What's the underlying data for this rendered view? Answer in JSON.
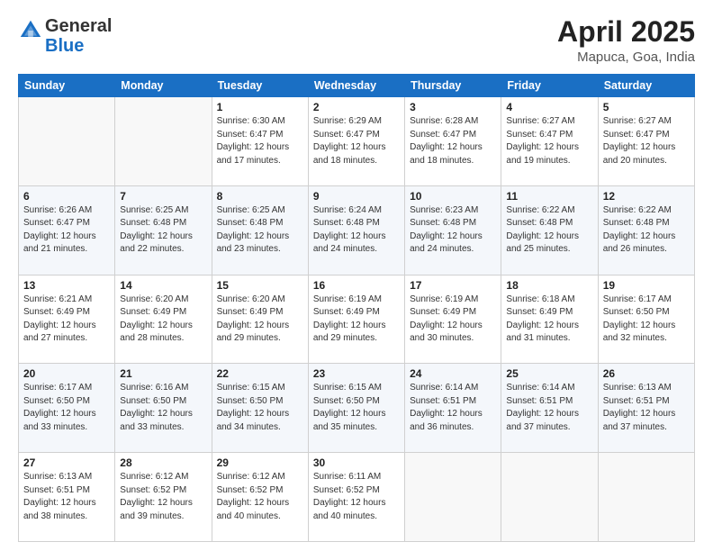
{
  "header": {
    "logo_general": "General",
    "logo_blue": "Blue",
    "title": "April 2025",
    "location": "Mapuca, Goa, India"
  },
  "days_of_week": [
    "Sunday",
    "Monday",
    "Tuesday",
    "Wednesday",
    "Thursday",
    "Friday",
    "Saturday"
  ],
  "weeks": [
    [
      {
        "day": "",
        "info": ""
      },
      {
        "day": "",
        "info": ""
      },
      {
        "day": "1",
        "info": "Sunrise: 6:30 AM\nSunset: 6:47 PM\nDaylight: 12 hours and 17 minutes."
      },
      {
        "day": "2",
        "info": "Sunrise: 6:29 AM\nSunset: 6:47 PM\nDaylight: 12 hours and 18 minutes."
      },
      {
        "day": "3",
        "info": "Sunrise: 6:28 AM\nSunset: 6:47 PM\nDaylight: 12 hours and 18 minutes."
      },
      {
        "day": "4",
        "info": "Sunrise: 6:27 AM\nSunset: 6:47 PM\nDaylight: 12 hours and 19 minutes."
      },
      {
        "day": "5",
        "info": "Sunrise: 6:27 AM\nSunset: 6:47 PM\nDaylight: 12 hours and 20 minutes."
      }
    ],
    [
      {
        "day": "6",
        "info": "Sunrise: 6:26 AM\nSunset: 6:47 PM\nDaylight: 12 hours and 21 minutes."
      },
      {
        "day": "7",
        "info": "Sunrise: 6:25 AM\nSunset: 6:48 PM\nDaylight: 12 hours and 22 minutes."
      },
      {
        "day": "8",
        "info": "Sunrise: 6:25 AM\nSunset: 6:48 PM\nDaylight: 12 hours and 23 minutes."
      },
      {
        "day": "9",
        "info": "Sunrise: 6:24 AM\nSunset: 6:48 PM\nDaylight: 12 hours and 24 minutes."
      },
      {
        "day": "10",
        "info": "Sunrise: 6:23 AM\nSunset: 6:48 PM\nDaylight: 12 hours and 24 minutes."
      },
      {
        "day": "11",
        "info": "Sunrise: 6:22 AM\nSunset: 6:48 PM\nDaylight: 12 hours and 25 minutes."
      },
      {
        "day": "12",
        "info": "Sunrise: 6:22 AM\nSunset: 6:48 PM\nDaylight: 12 hours and 26 minutes."
      }
    ],
    [
      {
        "day": "13",
        "info": "Sunrise: 6:21 AM\nSunset: 6:49 PM\nDaylight: 12 hours and 27 minutes."
      },
      {
        "day": "14",
        "info": "Sunrise: 6:20 AM\nSunset: 6:49 PM\nDaylight: 12 hours and 28 minutes."
      },
      {
        "day": "15",
        "info": "Sunrise: 6:20 AM\nSunset: 6:49 PM\nDaylight: 12 hours and 29 minutes."
      },
      {
        "day": "16",
        "info": "Sunrise: 6:19 AM\nSunset: 6:49 PM\nDaylight: 12 hours and 29 minutes."
      },
      {
        "day": "17",
        "info": "Sunrise: 6:19 AM\nSunset: 6:49 PM\nDaylight: 12 hours and 30 minutes."
      },
      {
        "day": "18",
        "info": "Sunrise: 6:18 AM\nSunset: 6:49 PM\nDaylight: 12 hours and 31 minutes."
      },
      {
        "day": "19",
        "info": "Sunrise: 6:17 AM\nSunset: 6:50 PM\nDaylight: 12 hours and 32 minutes."
      }
    ],
    [
      {
        "day": "20",
        "info": "Sunrise: 6:17 AM\nSunset: 6:50 PM\nDaylight: 12 hours and 33 minutes."
      },
      {
        "day": "21",
        "info": "Sunrise: 6:16 AM\nSunset: 6:50 PM\nDaylight: 12 hours and 33 minutes."
      },
      {
        "day": "22",
        "info": "Sunrise: 6:15 AM\nSunset: 6:50 PM\nDaylight: 12 hours and 34 minutes."
      },
      {
        "day": "23",
        "info": "Sunrise: 6:15 AM\nSunset: 6:50 PM\nDaylight: 12 hours and 35 minutes."
      },
      {
        "day": "24",
        "info": "Sunrise: 6:14 AM\nSunset: 6:51 PM\nDaylight: 12 hours and 36 minutes."
      },
      {
        "day": "25",
        "info": "Sunrise: 6:14 AM\nSunset: 6:51 PM\nDaylight: 12 hours and 37 minutes."
      },
      {
        "day": "26",
        "info": "Sunrise: 6:13 AM\nSunset: 6:51 PM\nDaylight: 12 hours and 37 minutes."
      }
    ],
    [
      {
        "day": "27",
        "info": "Sunrise: 6:13 AM\nSunset: 6:51 PM\nDaylight: 12 hours and 38 minutes."
      },
      {
        "day": "28",
        "info": "Sunrise: 6:12 AM\nSunset: 6:52 PM\nDaylight: 12 hours and 39 minutes."
      },
      {
        "day": "29",
        "info": "Sunrise: 6:12 AM\nSunset: 6:52 PM\nDaylight: 12 hours and 40 minutes."
      },
      {
        "day": "30",
        "info": "Sunrise: 6:11 AM\nSunset: 6:52 PM\nDaylight: 12 hours and 40 minutes."
      },
      {
        "day": "",
        "info": ""
      },
      {
        "day": "",
        "info": ""
      },
      {
        "day": "",
        "info": ""
      }
    ]
  ]
}
